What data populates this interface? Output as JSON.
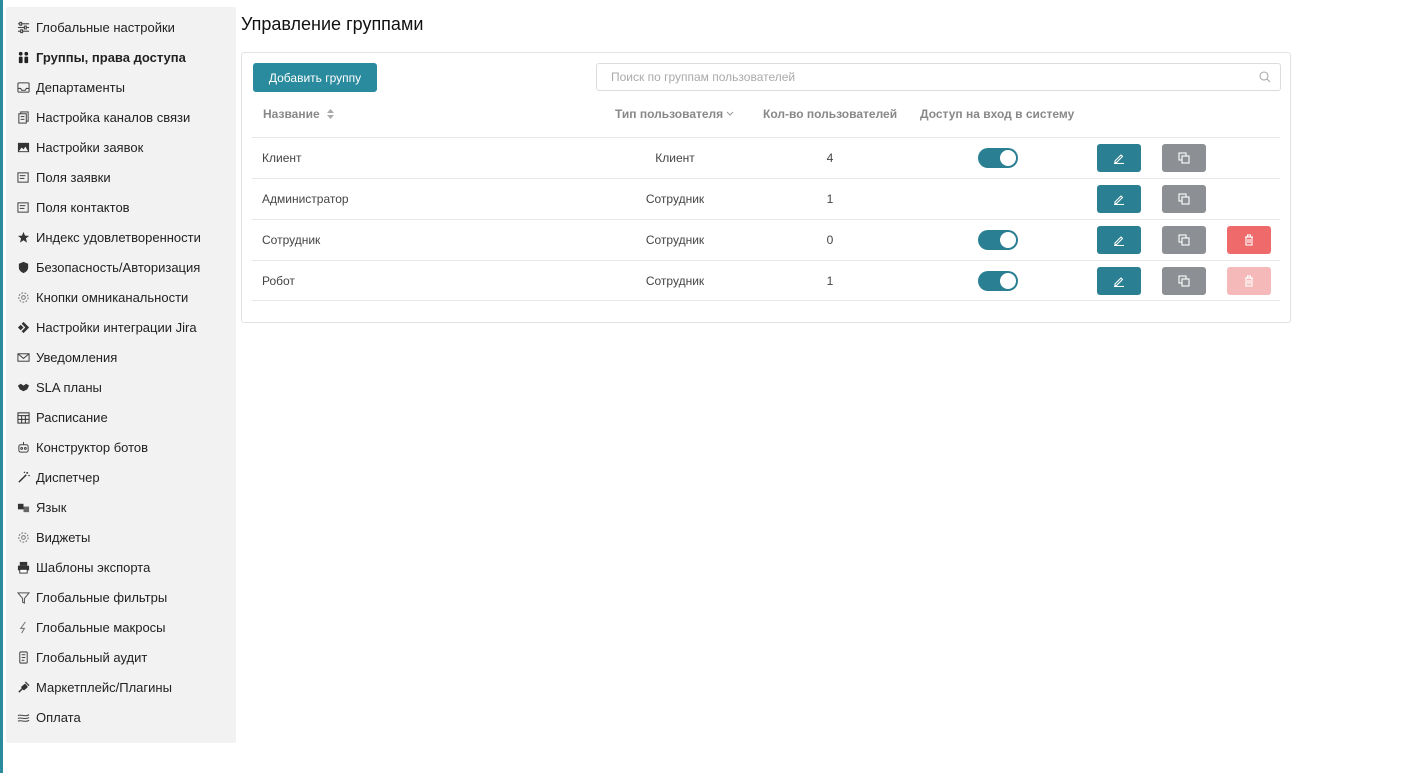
{
  "theme": {
    "accent": "#2a8a9e",
    "danger": "#ef6b6b",
    "neutral": "#8c8f93"
  },
  "sidebar": {
    "items": [
      {
        "label": "Глобальные настройки",
        "icon": "sliders-icon"
      },
      {
        "label": "Группы, права доступа",
        "icon": "users-icon",
        "active": true
      },
      {
        "label": "Департаменты",
        "icon": "inbox-icon"
      },
      {
        "label": "Настройка каналов связи",
        "icon": "copy-doc-icon"
      },
      {
        "label": "Настройки заявок",
        "icon": "image-icon"
      },
      {
        "label": "Поля заявки",
        "icon": "form-icon"
      },
      {
        "label": "Поля контактов",
        "icon": "form-icon"
      },
      {
        "label": "Индекс удовлетворенности",
        "icon": "star-icon"
      },
      {
        "label": "Безопасность/Авторизация",
        "icon": "shield-icon"
      },
      {
        "label": "Кнопки омниканальности",
        "icon": "gear-icon"
      },
      {
        "label": "Настройки интеграции Jira",
        "icon": "jira-icon"
      },
      {
        "label": "Уведомления",
        "icon": "envelope-icon"
      },
      {
        "label": "SLA планы",
        "icon": "handshake-icon"
      },
      {
        "label": "Расписание",
        "icon": "calendar-icon"
      },
      {
        "label": "Конструктор ботов",
        "icon": "robot-icon"
      },
      {
        "label": "Диспетчер",
        "icon": "magic-wand-icon"
      },
      {
        "label": "Язык",
        "icon": "language-icon"
      },
      {
        "label": "Виджеты",
        "icon": "gear-icon"
      },
      {
        "label": "Шаблоны экспорта",
        "icon": "printer-icon"
      },
      {
        "label": "Глобальные фильтры",
        "icon": "filter-icon"
      },
      {
        "label": "Глобальные макросы",
        "icon": "bolt-icon"
      },
      {
        "label": "Глобальный аудит",
        "icon": "scroll-icon"
      },
      {
        "label": "Маркетплейс/Плагины",
        "icon": "plug-icon"
      },
      {
        "label": "Оплата",
        "icon": "money-icon"
      }
    ]
  },
  "page": {
    "title": "Управление группами"
  },
  "toolbar": {
    "add_label": "Добавить группу",
    "search_placeholder": "Поиск по группам пользователей"
  },
  "table": {
    "columns": {
      "name": "Название",
      "user_type": "Тип пользователя",
      "user_count": "Кол-во пользователей",
      "login_access": "Доступ на вход в систему"
    },
    "rows": [
      {
        "name": "Клиент",
        "user_type": "Клиент",
        "user_count": "4",
        "login_access": true,
        "deletable": false,
        "show_delete": false
      },
      {
        "name": "Администратор",
        "user_type": "Сотрудник",
        "user_count": "1",
        "login_access": null,
        "deletable": false,
        "show_delete": false
      },
      {
        "name": "Сотрудник",
        "user_type": "Сотрудник",
        "user_count": "0",
        "login_access": true,
        "deletable": true,
        "show_delete": true
      },
      {
        "name": "Робот",
        "user_type": "Сотрудник",
        "user_count": "1",
        "login_access": true,
        "deletable": false,
        "show_delete": true
      }
    ]
  }
}
